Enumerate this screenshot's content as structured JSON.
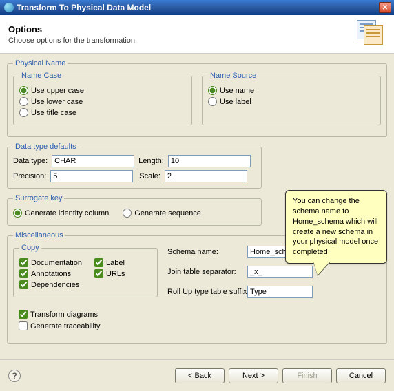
{
  "title": "Transform To Physical Data Model",
  "header": {
    "title": "Options",
    "subtitle": "Choose options for the transformation."
  },
  "physName": {
    "legend": "Physical Name",
    "nameCase": {
      "legend": "Name Case",
      "upper": "Use upper case",
      "lower": "Use lower case",
      "title": "Use title case"
    },
    "nameSource": {
      "legend": "Name Source",
      "name": "Use name",
      "label": "Use label"
    }
  },
  "dataDefaults": {
    "legend": "Data type defaults",
    "dataTypeLabel": "Data type:",
    "dataType": "CHAR",
    "lengthLabel": "Length:",
    "length": "10",
    "precisionLabel": "Precision:",
    "precision": "5",
    "scaleLabel": "Scale:",
    "scale": "2"
  },
  "surrogate": {
    "legend": "Surrogate key",
    "identity": "Generate identity column",
    "sequence": "Generate sequence"
  },
  "misc": {
    "legend": "Miscellaneous",
    "copy": {
      "legend": "Copy",
      "documentation": "Documentation",
      "annotations": "Annotations",
      "dependencies": "Dependencies",
      "label": "Label",
      "urls": "URLs"
    },
    "schemaNameLabel": "Schema name:",
    "schemaName": "Home_schema",
    "joinSepLabel": "Join table separator:",
    "joinSep": "_x_",
    "rollupLabel": "Roll Up type table suffix:",
    "rollup": "Type",
    "transformDiagrams": "Transform diagrams",
    "generateTraceability": "Generate traceability"
  },
  "callout": "You can change the schema name to Home_schema which will create a new schema in your physical model once completed",
  "buttons": {
    "back": "< Back",
    "next": "Next >",
    "finish": "Finish",
    "cancel": "Cancel"
  }
}
